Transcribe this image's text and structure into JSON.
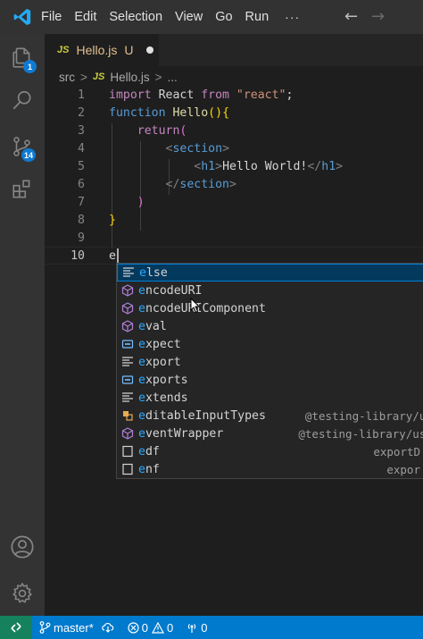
{
  "titlebar": {
    "menu": [
      "File",
      "Edit",
      "Selection",
      "View",
      "Go",
      "Run"
    ],
    "more_label": "···",
    "back_icon": "arrow-left-icon",
    "forward_icon": "arrow-right-icon"
  },
  "activitybar": {
    "explorer_badge": "1",
    "scm_badge": "14"
  },
  "tab": {
    "lang_badge": "JS",
    "filename": "Hello.js",
    "status": "U"
  },
  "breadcrumb": {
    "folder": "src",
    "sep": ">",
    "lang_badge": "JS",
    "file": "Hello.js",
    "sep2": ">",
    "symbol": "..."
  },
  "editor": {
    "line_numbers": [
      "1",
      "2",
      "3",
      "4",
      "5",
      "6",
      "7",
      "8",
      "9",
      "10"
    ],
    "line1": {
      "kw": "import",
      "id": " React ",
      "from": "from",
      "str": " \"react\"",
      "end": ";"
    },
    "line2": {
      "kw": "function",
      "name": " Hello",
      "paren": "()",
      "brace": "{"
    },
    "line3": {
      "kw": "return",
      "paren": "("
    },
    "line4": {
      "open": "<",
      "tag": "section",
      "close": ">"
    },
    "line5": {
      "open": "<",
      "tag": "h1",
      "close": ">",
      "text": "Hello World!",
      "open2": "</",
      "tag2": "h1",
      "close2": ">"
    },
    "line6": {
      "open": "</",
      "tag": "section",
      "close": ">"
    },
    "line7": {
      "paren": ")"
    },
    "line8": {
      "brace": "}"
    },
    "line10": {
      "typed": "e"
    }
  },
  "suggest": {
    "items": [
      {
        "label": "else",
        "kind": "snippet",
        "detail": ""
      },
      {
        "label": "encodeURI",
        "kind": "method",
        "detail": ""
      },
      {
        "label": "encodeURIComponent",
        "kind": "method",
        "detail": ""
      },
      {
        "label": "eval",
        "kind": "method",
        "detail": ""
      },
      {
        "label": "expect",
        "kind": "variable",
        "detail": ""
      },
      {
        "label": "export",
        "kind": "keyword",
        "detail": ""
      },
      {
        "label": "exports",
        "kind": "variable",
        "detail": ""
      },
      {
        "label": "extends",
        "kind": "keyword",
        "detail": ""
      },
      {
        "label": "editableInputTypes",
        "kind": "field",
        "detail": "@testing-library/user-e"
      },
      {
        "label": "eventWrapper",
        "kind": "method",
        "detail": "@testing-library/user-ev"
      },
      {
        "label": "edf",
        "kind": "text",
        "detail": "exportD"
      },
      {
        "label": "enf",
        "kind": "text",
        "detail": "expor"
      }
    ]
  },
  "statusbar": {
    "branch": "master*",
    "errors": "0",
    "warnings": "0",
    "ports": "0"
  },
  "colors": {
    "accent": "#007acc",
    "remote": "#16825d",
    "selection": "#04395e"
  }
}
